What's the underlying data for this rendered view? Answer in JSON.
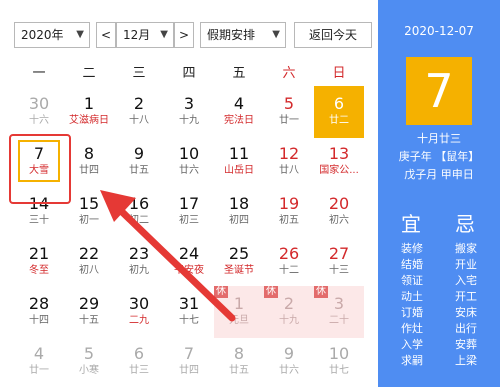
{
  "toolbar": {
    "year": "2020年",
    "prev": "<",
    "month": "12月",
    "next": ">",
    "holiday_select": "假期安排",
    "today_button": "返回今天"
  },
  "weekdays": [
    "一",
    "二",
    "三",
    "四",
    "五",
    "六",
    "日"
  ],
  "weeks": [
    [
      {
        "day": "30",
        "lunar": "十六",
        "kind": "other"
      },
      {
        "day": "1",
        "lunar": "艾滋病日",
        "kind": "fest"
      },
      {
        "day": "2",
        "lunar": "十八"
      },
      {
        "day": "3",
        "lunar": "十九"
      },
      {
        "day": "4",
        "lunar": "宪法日",
        "kind": "fest"
      },
      {
        "day": "5",
        "lunar": "廿一",
        "we": true
      },
      {
        "day": "6",
        "lunar": "廿二",
        "kind": "today"
      }
    ],
    [
      {
        "day": "7",
        "lunar": "大雪",
        "kind": "fest",
        "selected": true
      },
      {
        "day": "8",
        "lunar": "廿四"
      },
      {
        "day": "9",
        "lunar": "廿五"
      },
      {
        "day": "10",
        "lunar": "廿六"
      },
      {
        "day": "11",
        "lunar": "山岳日",
        "kind": "fest"
      },
      {
        "day": "12",
        "lunar": "廿八",
        "we": true
      },
      {
        "day": "13",
        "lunar": "国家公...",
        "kind": "fest",
        "we": true
      }
    ],
    [
      {
        "day": "14",
        "lunar": "三十"
      },
      {
        "day": "15",
        "lunar": "初一"
      },
      {
        "day": "16",
        "lunar": "初二"
      },
      {
        "day": "17",
        "lunar": "初三"
      },
      {
        "day": "18",
        "lunar": "初四"
      },
      {
        "day": "19",
        "lunar": "初五",
        "we": true
      },
      {
        "day": "20",
        "lunar": "初六",
        "we": true
      }
    ],
    [
      {
        "day": "21",
        "lunar": "冬至",
        "kind": "fest"
      },
      {
        "day": "22",
        "lunar": "初八"
      },
      {
        "day": "23",
        "lunar": "初九"
      },
      {
        "day": "24",
        "lunar": "平安夜",
        "kind": "fest"
      },
      {
        "day": "25",
        "lunar": "圣诞节",
        "kind": "fest"
      },
      {
        "day": "26",
        "lunar": "十二",
        "we": true
      },
      {
        "day": "27",
        "lunar": "十三",
        "we": true
      }
    ],
    [
      {
        "day": "28",
        "lunar": "十四"
      },
      {
        "day": "29",
        "lunar": "十五"
      },
      {
        "day": "30",
        "lunar": "二九",
        "kind": "fest"
      },
      {
        "day": "31",
        "lunar": "十七"
      },
      {
        "day": "1",
        "lunar": "元旦",
        "kind": "holiday",
        "badge": "休"
      },
      {
        "day": "2",
        "lunar": "十九",
        "kind": "holiday",
        "badge": "休"
      },
      {
        "day": "3",
        "lunar": "二十",
        "kind": "holiday",
        "badge": "休"
      }
    ],
    [
      {
        "day": "4",
        "lunar": "廿一",
        "kind": "other"
      },
      {
        "day": "5",
        "lunar": "小寒",
        "kind": "other"
      },
      {
        "day": "6",
        "lunar": "廿三",
        "kind": "other"
      },
      {
        "day": "7",
        "lunar": "廿四",
        "kind": "other"
      },
      {
        "day": "8",
        "lunar": "廿五",
        "kind": "other"
      },
      {
        "day": "9",
        "lunar": "廿六",
        "kind": "other"
      },
      {
        "day": "10",
        "lunar": "廿七",
        "kind": "other"
      }
    ]
  ],
  "side": {
    "date": "2020-12-07",
    "big_day": "7",
    "lunar_line": "十月廿三",
    "ganzhi_year": "庚子年 【鼠年】",
    "ganzhi_day": "戊子月 甲申日",
    "yi_title": "宜",
    "ji_title": "忌",
    "yi": [
      "装修",
      "结婚",
      "领证",
      "动土",
      "订婚",
      "作灶",
      "入学",
      "求嗣"
    ],
    "ji": [
      "搬家",
      "开业",
      "入宅",
      "开工",
      "安床",
      "出行",
      "安葬",
      "上梁"
    ]
  }
}
